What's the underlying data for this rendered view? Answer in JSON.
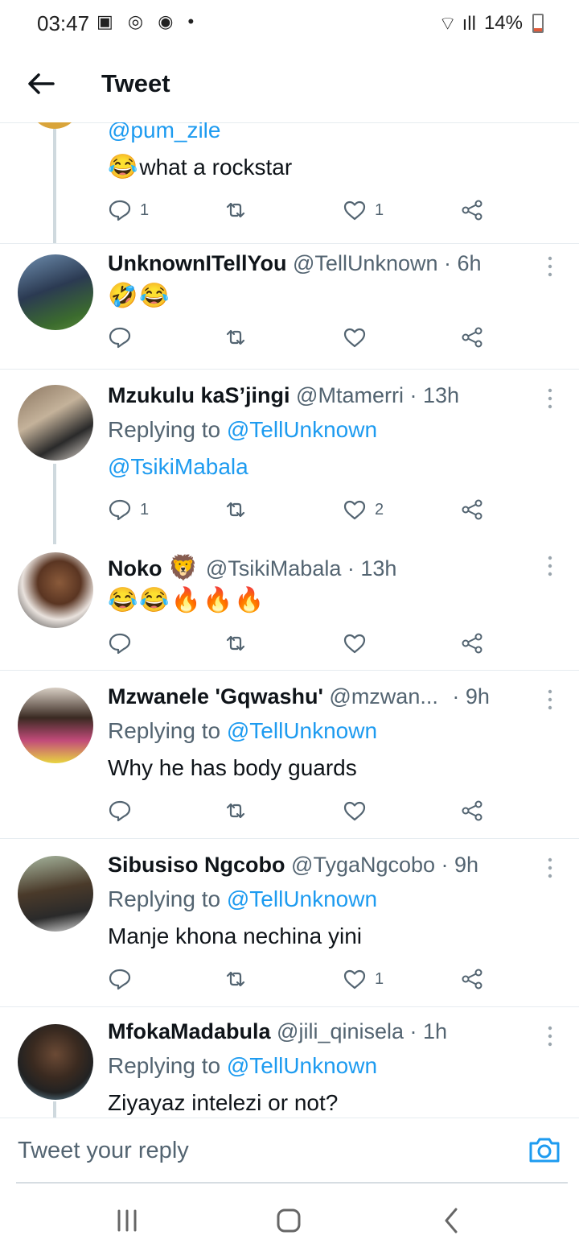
{
  "status_bar": {
    "time": "03:47",
    "battery": "14%"
  },
  "header": {
    "title": "Tweet"
  },
  "tweets": [
    {
      "mention": "@pum_zile",
      "text": "what a rockstar",
      "emoji": "😂",
      "replies": "1",
      "likes": "1"
    },
    {
      "name": "UnknownITellYou",
      "handle": "@TellUnknown · 6h",
      "emoji": "🤣😂"
    },
    {
      "name": "Mzukulu kaS’jingi",
      "handle": "@Mtamerri · 13h",
      "replying_prefix": "Replying to ",
      "replying_to": "@TellUnknown",
      "text": "@TsikiMabala",
      "replies": "1",
      "likes": "2"
    },
    {
      "name": "Noko",
      "name_emoji": "🦁",
      "handle": "@TsikiMabala · 13h",
      "emoji": "😂😂🔥🔥🔥"
    },
    {
      "name": "Mzwanele 'Gqwashu'",
      "handle": "@mzwan...",
      "time": "· 9h",
      "replying_prefix": "Replying to ",
      "replying_to": "@TellUnknown",
      "text": "Why he has body guards"
    },
    {
      "name": "Sibusiso Ngcobo",
      "handle": "@TygaNgcobo · 9h",
      "replying_prefix": "Replying to ",
      "replying_to": "@TellUnknown",
      "text": "Manje khona nechina yini",
      "likes": "1"
    },
    {
      "name": "MfokaMadabula",
      "handle": "@jili_qinisela · 1h",
      "replying_prefix": "Replying to ",
      "replying_to": "@TellUnknown",
      "text": "Ziyayaz intelezi or not?"
    }
  ],
  "reply_bar": {
    "placeholder": "Tweet your reply"
  },
  "icons": [
    "back-arrow-icon",
    "reply-icon",
    "retweet-icon",
    "like-icon",
    "share-icon",
    "more-icon",
    "camera-icon",
    "recent-apps-icon",
    "home-icon",
    "back-nav-icon"
  ],
  "colors": {
    "link": "#1d9bf0",
    "secondary_text": "#536471",
    "divider": "#e6ecf0"
  }
}
